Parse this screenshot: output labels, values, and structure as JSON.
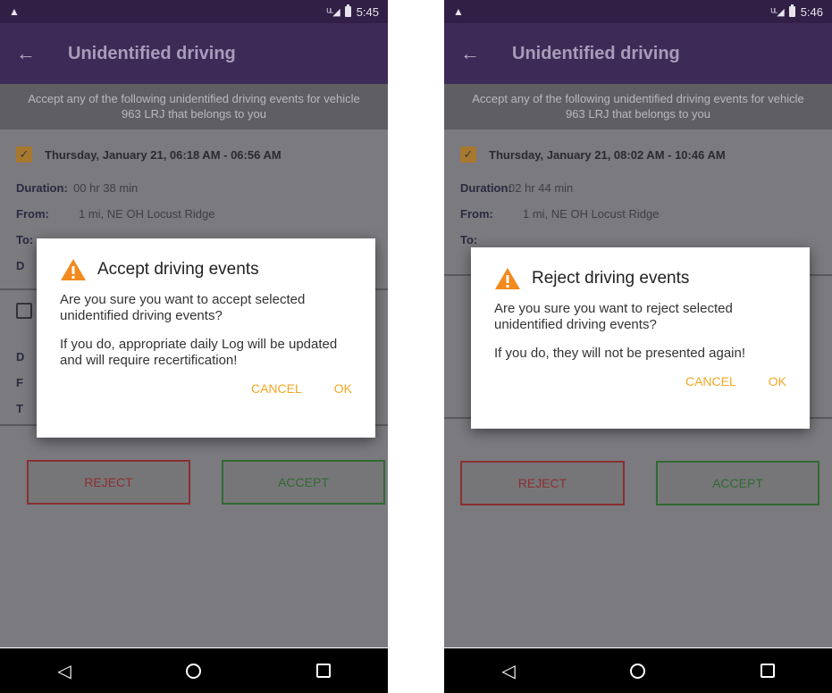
{
  "colors": {
    "status_bar": "#311f45",
    "app_bar": "#3e2a56",
    "accent_orange": "#f5a623",
    "reject_red": "#c62828",
    "accept_green": "#2e7d32"
  },
  "left": {
    "status": {
      "signal": "ᵁᴸ◢",
      "time": "5:45"
    },
    "app_bar": {
      "back_icon": "←",
      "title": "Unidentified driving"
    },
    "banner": "Accept any of the following unidentified driving events for vehicle 963 LRJ that belongs to you",
    "event1": {
      "checked": true,
      "header": "Thursday, January 21, 06:18 AM - 06:56 AM",
      "duration_label": "Duration:",
      "duration_value": "00 hr  38 min",
      "from_label": "From:",
      "from_value": "1 mi, NE OH Locust Ridge",
      "to_label": "To:",
      "d_label": "D"
    },
    "event2": {
      "checked": false,
      "d_label": "D",
      "f_label": "F",
      "t_label": "T"
    },
    "buttons": {
      "reject": "REJECT",
      "accept": "ACCEPT"
    },
    "dialog": {
      "title": "Accept driving events",
      "message1": "Are you sure you want to accept selected unidentified driving events?",
      "message2": "If you do, appropriate daily Log will be updated and will require recertification!",
      "cancel": "CANCEL",
      "ok": "OK"
    }
  },
  "right": {
    "status": {
      "signal": "ᵁᴸ◢",
      "time": "5:46"
    },
    "app_bar": {
      "back_icon": "←",
      "title": "Unidentified driving"
    },
    "banner": "Accept any of the following unidentified driving events for vehicle 963 LRJ that belongs to you",
    "event1": {
      "checked": true,
      "header": "Thursday, January 21, 08:02 AM - 10:46 AM",
      "duration_label": "Duration:",
      "duration_value": "02 hr  44 min",
      "from_label": "From:",
      "from_value": "1 mi, NE OH Locust Ridge",
      "to_label": "To:"
    },
    "buttons": {
      "reject": "REJECT",
      "accept": "ACCEPT"
    },
    "dialog": {
      "title": "Reject driving events",
      "message1": "Are you sure you want to reject selected unidentified driving events?",
      "message2": "If you do, they will not be presented again!",
      "cancel": "CANCEL",
      "ok": "OK"
    }
  }
}
